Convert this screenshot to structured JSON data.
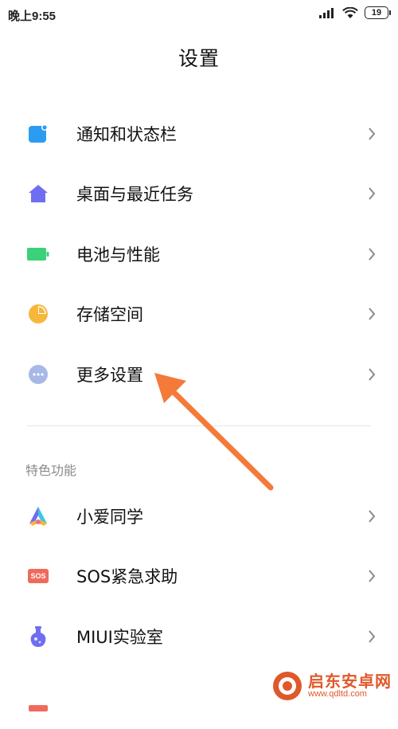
{
  "status_bar": {
    "time": "晚上9:55",
    "battery": "19"
  },
  "header": {
    "title": "设置"
  },
  "settings": {
    "items": [
      {
        "label": "通知和状态栏",
        "icon": "notification-icon",
        "color": "#2c9cf2"
      },
      {
        "label": "桌面与最近任务",
        "icon": "home-icon",
        "color": "#6f6ef0"
      },
      {
        "label": "电池与性能",
        "icon": "battery-icon",
        "color": "#3cd07a"
      },
      {
        "label": "存储空间",
        "icon": "storage-pie-icon",
        "color": "#f6b73c"
      },
      {
        "label": "更多设置",
        "icon": "more-dots-icon",
        "color": "#a6b8e6"
      }
    ]
  },
  "features": {
    "header": "特色功能",
    "items": [
      {
        "label": "小爱同学",
        "icon": "xiaoai-icon"
      },
      {
        "label": "SOS紧急求助",
        "icon": "sos-icon",
        "icon_text": "SOS",
        "color": "#f06a5c"
      },
      {
        "label": "MIUI实验室",
        "icon": "lab-flask-icon",
        "color": "#6f6ef0"
      },
      {
        "label": "",
        "icon": "partial-icon",
        "color": "#f06a5c"
      }
    ]
  },
  "annotation": {
    "arrow_color": "#f47a3a"
  },
  "watermark": {
    "title": "启东安卓网",
    "url": "www.qdltd.com"
  }
}
